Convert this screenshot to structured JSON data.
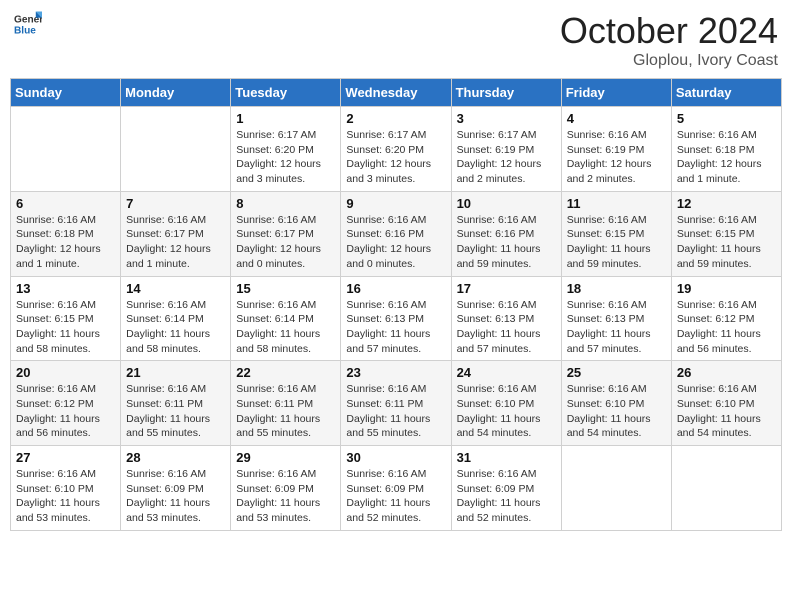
{
  "header": {
    "logo_general": "General",
    "logo_blue": "Blue",
    "title": "October 2024",
    "location": "Gloplou, Ivory Coast"
  },
  "days_of_week": [
    "Sunday",
    "Monday",
    "Tuesday",
    "Wednesday",
    "Thursday",
    "Friday",
    "Saturday"
  ],
  "weeks": [
    [
      {
        "day": "",
        "info": ""
      },
      {
        "day": "",
        "info": ""
      },
      {
        "day": "1",
        "info": "Sunrise: 6:17 AM\nSunset: 6:20 PM\nDaylight: 12 hours and 3 minutes."
      },
      {
        "day": "2",
        "info": "Sunrise: 6:17 AM\nSunset: 6:20 PM\nDaylight: 12 hours and 3 minutes."
      },
      {
        "day": "3",
        "info": "Sunrise: 6:17 AM\nSunset: 6:19 PM\nDaylight: 12 hours and 2 minutes."
      },
      {
        "day": "4",
        "info": "Sunrise: 6:16 AM\nSunset: 6:19 PM\nDaylight: 12 hours and 2 minutes."
      },
      {
        "day": "5",
        "info": "Sunrise: 6:16 AM\nSunset: 6:18 PM\nDaylight: 12 hours and 1 minute."
      }
    ],
    [
      {
        "day": "6",
        "info": "Sunrise: 6:16 AM\nSunset: 6:18 PM\nDaylight: 12 hours and 1 minute."
      },
      {
        "day": "7",
        "info": "Sunrise: 6:16 AM\nSunset: 6:17 PM\nDaylight: 12 hours and 1 minute."
      },
      {
        "day": "8",
        "info": "Sunrise: 6:16 AM\nSunset: 6:17 PM\nDaylight: 12 hours and 0 minutes."
      },
      {
        "day": "9",
        "info": "Sunrise: 6:16 AM\nSunset: 6:16 PM\nDaylight: 12 hours and 0 minutes."
      },
      {
        "day": "10",
        "info": "Sunrise: 6:16 AM\nSunset: 6:16 PM\nDaylight: 11 hours and 59 minutes."
      },
      {
        "day": "11",
        "info": "Sunrise: 6:16 AM\nSunset: 6:15 PM\nDaylight: 11 hours and 59 minutes."
      },
      {
        "day": "12",
        "info": "Sunrise: 6:16 AM\nSunset: 6:15 PM\nDaylight: 11 hours and 59 minutes."
      }
    ],
    [
      {
        "day": "13",
        "info": "Sunrise: 6:16 AM\nSunset: 6:15 PM\nDaylight: 11 hours and 58 minutes."
      },
      {
        "day": "14",
        "info": "Sunrise: 6:16 AM\nSunset: 6:14 PM\nDaylight: 11 hours and 58 minutes."
      },
      {
        "day": "15",
        "info": "Sunrise: 6:16 AM\nSunset: 6:14 PM\nDaylight: 11 hours and 58 minutes."
      },
      {
        "day": "16",
        "info": "Sunrise: 6:16 AM\nSunset: 6:13 PM\nDaylight: 11 hours and 57 minutes."
      },
      {
        "day": "17",
        "info": "Sunrise: 6:16 AM\nSunset: 6:13 PM\nDaylight: 11 hours and 57 minutes."
      },
      {
        "day": "18",
        "info": "Sunrise: 6:16 AM\nSunset: 6:13 PM\nDaylight: 11 hours and 57 minutes."
      },
      {
        "day": "19",
        "info": "Sunrise: 6:16 AM\nSunset: 6:12 PM\nDaylight: 11 hours and 56 minutes."
      }
    ],
    [
      {
        "day": "20",
        "info": "Sunrise: 6:16 AM\nSunset: 6:12 PM\nDaylight: 11 hours and 56 minutes."
      },
      {
        "day": "21",
        "info": "Sunrise: 6:16 AM\nSunset: 6:11 PM\nDaylight: 11 hours and 55 minutes."
      },
      {
        "day": "22",
        "info": "Sunrise: 6:16 AM\nSunset: 6:11 PM\nDaylight: 11 hours and 55 minutes."
      },
      {
        "day": "23",
        "info": "Sunrise: 6:16 AM\nSunset: 6:11 PM\nDaylight: 11 hours and 55 minutes."
      },
      {
        "day": "24",
        "info": "Sunrise: 6:16 AM\nSunset: 6:10 PM\nDaylight: 11 hours and 54 minutes."
      },
      {
        "day": "25",
        "info": "Sunrise: 6:16 AM\nSunset: 6:10 PM\nDaylight: 11 hours and 54 minutes."
      },
      {
        "day": "26",
        "info": "Sunrise: 6:16 AM\nSunset: 6:10 PM\nDaylight: 11 hours and 54 minutes."
      }
    ],
    [
      {
        "day": "27",
        "info": "Sunrise: 6:16 AM\nSunset: 6:10 PM\nDaylight: 11 hours and 53 minutes."
      },
      {
        "day": "28",
        "info": "Sunrise: 6:16 AM\nSunset: 6:09 PM\nDaylight: 11 hours and 53 minutes."
      },
      {
        "day": "29",
        "info": "Sunrise: 6:16 AM\nSunset: 6:09 PM\nDaylight: 11 hours and 53 minutes."
      },
      {
        "day": "30",
        "info": "Sunrise: 6:16 AM\nSunset: 6:09 PM\nDaylight: 11 hours and 52 minutes."
      },
      {
        "day": "31",
        "info": "Sunrise: 6:16 AM\nSunset: 6:09 PM\nDaylight: 11 hours and 52 minutes."
      },
      {
        "day": "",
        "info": ""
      },
      {
        "day": "",
        "info": ""
      }
    ]
  ]
}
